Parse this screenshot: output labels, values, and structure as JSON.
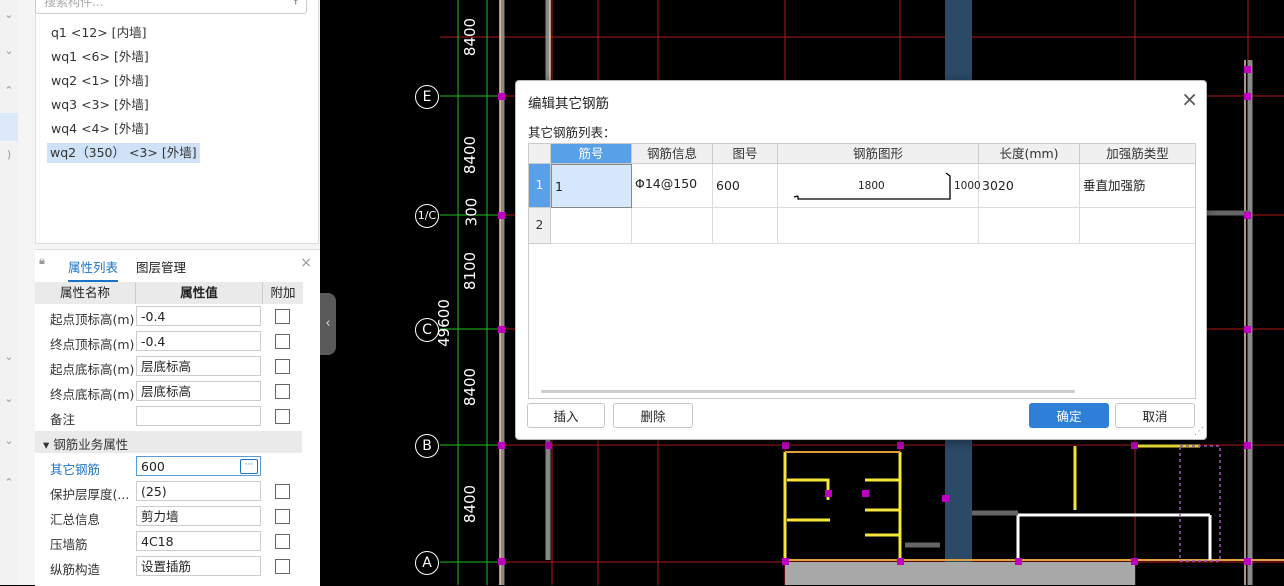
{
  "left_panel": {
    "search_placeholder": "搜索构件...",
    "tree_items": [
      "q1 <12> [内墙]",
      "wq1 <6> [外墙]",
      "wq2 <1> [外墙]",
      "wq3 <3> [外墙]",
      "wq4 <4> [外墙]",
      "wq2（350） <3> [外墙]"
    ],
    "tabs": [
      "属性列表",
      "图层管理"
    ],
    "prop_headers": [
      "属性名称",
      "属性值",
      "附加"
    ],
    "props": [
      {
        "name": "起点顶标高(m)",
        "value": "-0.4"
      },
      {
        "name": "终点顶标高(m)",
        "value": "-0.4"
      },
      {
        "name": "起点底标高(m)",
        "value": "层底标高"
      },
      {
        "name": "终点底标高(m)",
        "value": "层底标高"
      },
      {
        "name": "备注",
        "value": ""
      }
    ],
    "section": "钢筋业务属性",
    "props2": [
      {
        "name": "其它钢筋",
        "value": "600"
      },
      {
        "name": "保护层厚度(...",
        "value": "(25)"
      },
      {
        "name": "汇总信息",
        "value": "剪力墙"
      },
      {
        "name": "压墙筋",
        "value": "4C18"
      },
      {
        "name": "纵筋构造",
        "value": "设置插筋"
      }
    ]
  },
  "cad": {
    "axes": [
      "E",
      "1/C",
      "C",
      "B",
      "A"
    ],
    "dims": [
      "8400",
      "8400",
      "300",
      "8100",
      "8400",
      "8400"
    ],
    "total_dim": "49600"
  },
  "dialog": {
    "title": "编辑其它钢筋",
    "list_label": "其它钢筋列表：",
    "columns": [
      "筋号",
      "钢筋信息",
      "图号",
      "钢筋图形",
      "长度(mm)",
      "加强筋类型"
    ],
    "rows": [
      {
        "index": "1",
        "bar_no": "1",
        "info": "Φ14@150",
        "fig": "600",
        "shape_a": "1800",
        "shape_b": "1000",
        "length": "3020",
        "type": "垂直加强筋"
      },
      {
        "index": "2",
        "bar_no": "",
        "info": "",
        "fig": "",
        "shape_a": "",
        "shape_b": "",
        "length": "",
        "type": ""
      }
    ],
    "buttons": {
      "insert": "插入",
      "delete": "删除",
      "ok": "确定",
      "cancel": "取消"
    }
  }
}
